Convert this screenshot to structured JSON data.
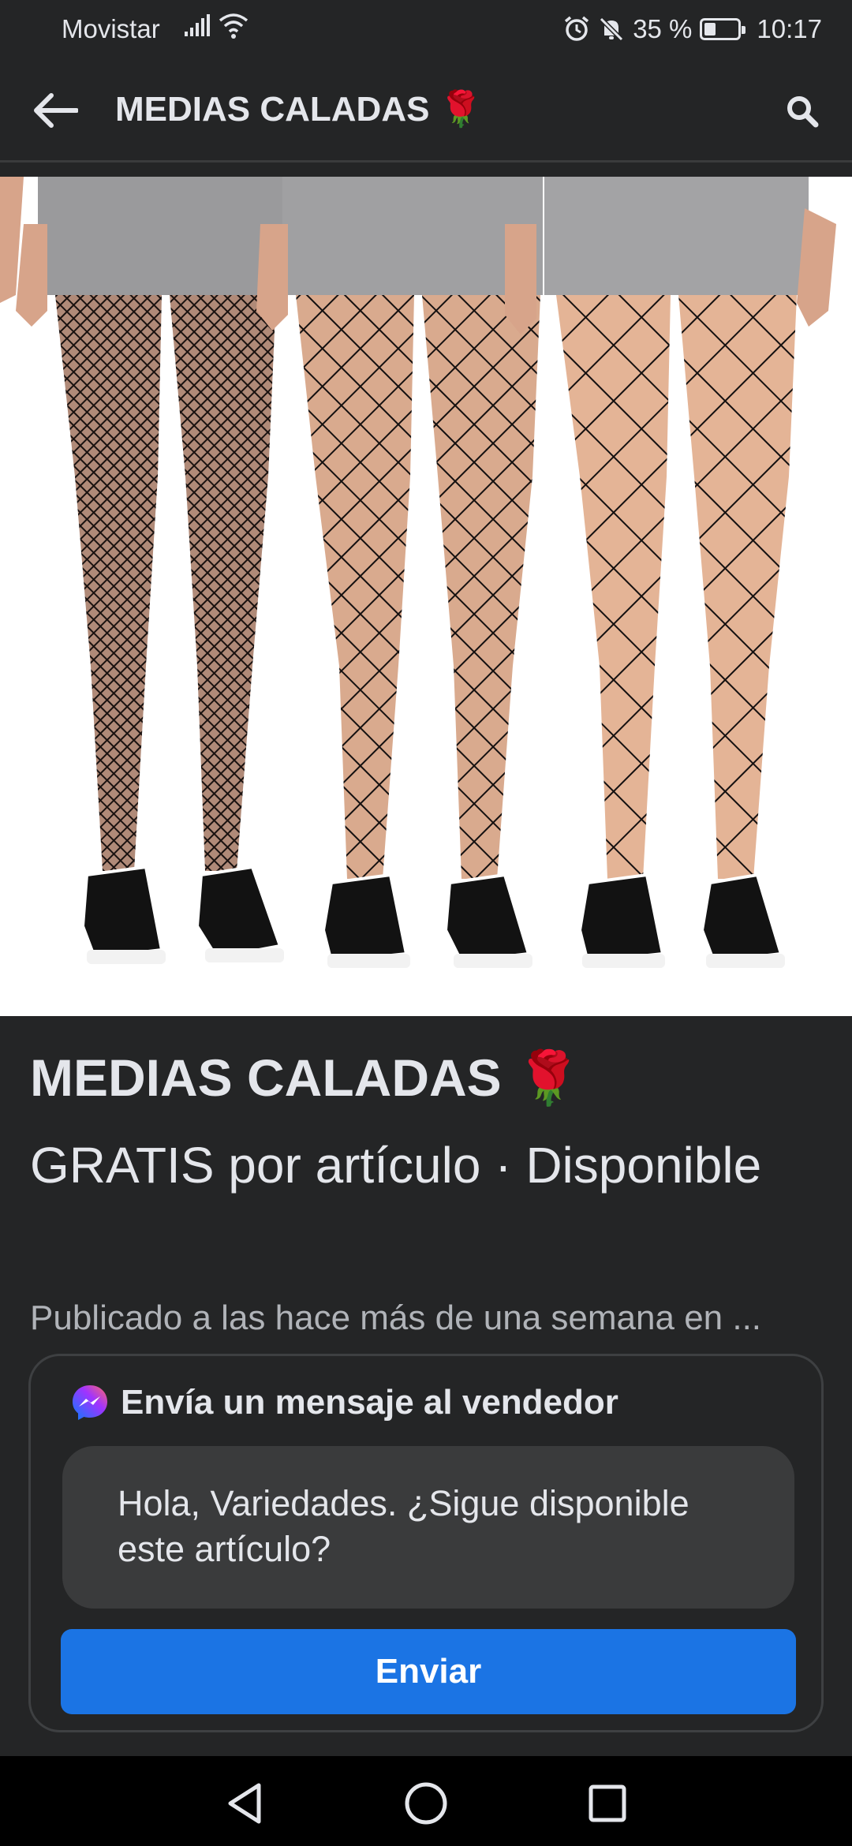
{
  "status_bar": {
    "carrier": "Movistar",
    "battery": "35 %",
    "battery_level": 0.35,
    "time": "10:17"
  },
  "app_bar": {
    "title": "MEDIAS CALADAS 🌹",
    "icons": {
      "back": "arrow-left-icon",
      "search": "search-icon"
    }
  },
  "listing": {
    "title": "MEDIAS CALADAS 🌹",
    "price_line": "GRATIS por artículo · Disponible",
    "posted": "Publicado a las hace más de una semana en ..."
  },
  "message": {
    "heading": "Envía un mensaje al vendedor",
    "input_value": "Hola, Variedades. ¿Sigue disponible este artículo?",
    "send_label": "Enviar",
    "send_color": "#1b74e4"
  },
  "nav_bar": {
    "icons": [
      "back-triangle-icon",
      "home-circle-icon",
      "recents-square-icon"
    ]
  }
}
